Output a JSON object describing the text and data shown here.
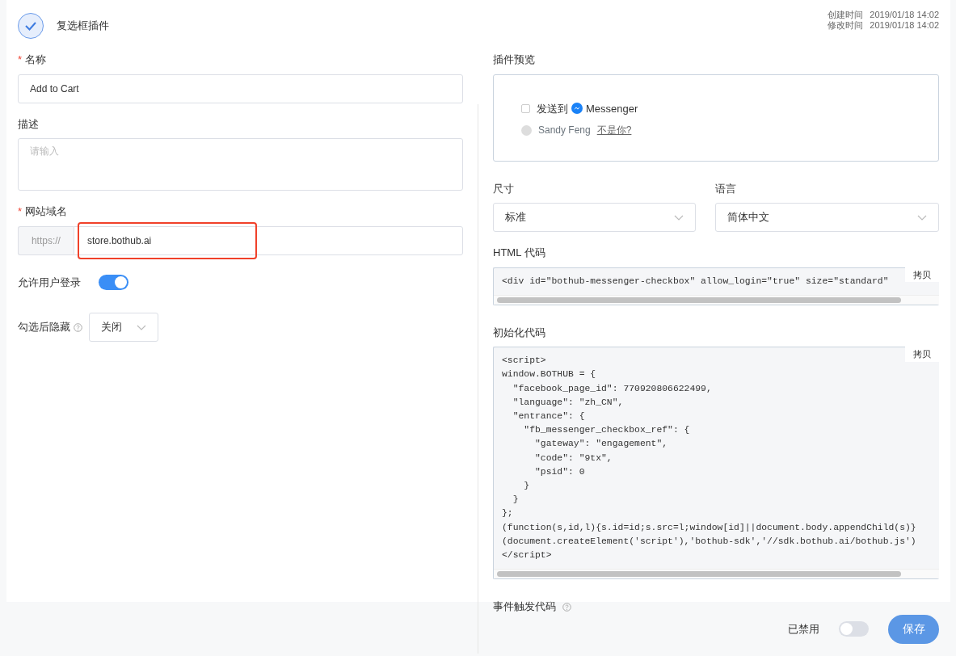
{
  "header": {
    "title": "复选框插件",
    "created_label": "创建时间",
    "created": "2019/01/18 14:02",
    "modified_label": "修改时间",
    "modified": "2019/01/18 14:02"
  },
  "form": {
    "name": {
      "required_mark": "*",
      "label": "名称",
      "value": "Add to Cart"
    },
    "description": {
      "label": "描述",
      "placeholder": "请输入"
    },
    "domain": {
      "required_mark": "*",
      "label": "网站域名",
      "prefix": "https://",
      "value": "store.bothub.ai",
      "highlighted": true
    },
    "allow_login": {
      "label": "允许用户登录",
      "on": true
    },
    "hide_after_check": {
      "label": "勾选后隐藏",
      "value": "关闭"
    }
  },
  "preview": {
    "label": "插件预览",
    "checked": false,
    "send_to": "发送到",
    "brand": "Messenger",
    "user": "Sandy Feng",
    "not_you": "不是你?"
  },
  "size": {
    "label": "尺寸",
    "value": "标准"
  },
  "language": {
    "label": "语言",
    "value": "简体中文"
  },
  "html_code": {
    "label": "HTML 代码",
    "copy": "拷贝",
    "lines": [
      "<div id=\"bothub-messenger-checkbox\" allow_login=\"true\" size=\"standard\""
    ]
  },
  "init_code": {
    "label": "初始化代码",
    "copy": "拷贝",
    "lines": [
      "<script>",
      "window.BOTHUB = {",
      "  \"facebook_page_id\": 770920806622499,",
      "  \"language\": \"zh_CN\",",
      "  \"entrance\": {",
      "    \"fb_messenger_checkbox_ref\": {",
      "      \"gateway\": \"engagement\",",
      "      \"code\": \"9tx\",",
      "      \"psid\": 0",
      "    }",
      "  }",
      "};",
      "(function(s,id,l){s.id=id;s.src=l;window[id]||document.body.appendChild(s)}",
      "(document.createElement('script'),'bothub-sdk','//sdk.bothub.ai/bothub.js')",
      "</script>"
    ]
  },
  "event_code": {
    "label": "事件触发代码"
  },
  "footer": {
    "status_label": "已禁用",
    "enabled": false,
    "save": "保存"
  }
}
